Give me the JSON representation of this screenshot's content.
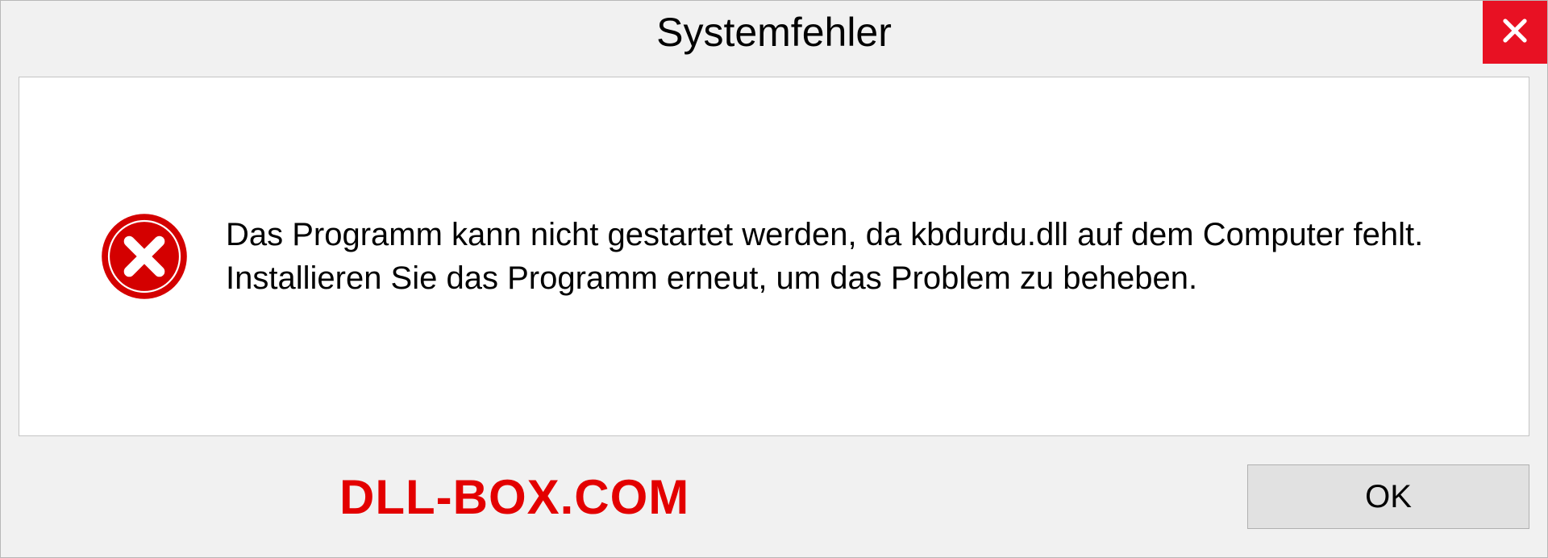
{
  "dialog": {
    "title": "Systemfehler",
    "message": "Das Programm kann nicht gestartet werden, da kbdurdu.dll auf dem Computer fehlt. Installieren Sie das Programm erneut, um das Problem zu beheben.",
    "ok_label": "OK"
  },
  "watermark": "DLL-BOX.COM",
  "colors": {
    "close_bg": "#e81123",
    "error_red": "#d40000",
    "watermark_red": "#e30000"
  }
}
